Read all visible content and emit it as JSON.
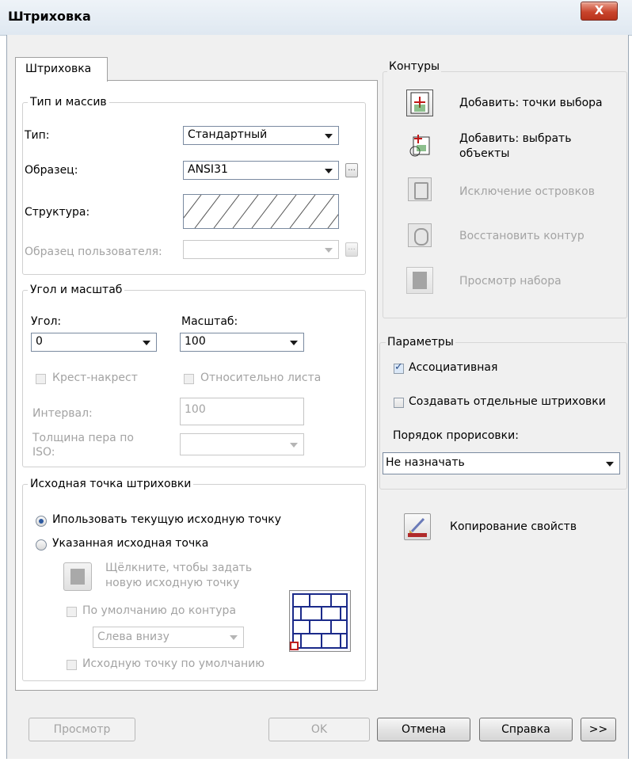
{
  "window": {
    "title": "Штриховка",
    "close_glyph": "X"
  },
  "tabs": [
    {
      "label": "Штриховка"
    }
  ],
  "type_group": {
    "legend": "Тип и массив",
    "type_label": "Тип:",
    "type_value": "Стандартный",
    "pattern_label": "Образец:",
    "pattern_value": "ANSI31",
    "ellipsis": "...",
    "structure_label": "Структура:",
    "custom_label": "Образец пользователя:",
    "custom_value": ""
  },
  "angle_group": {
    "legend": "Угол и масштаб",
    "angle_label": "Угол:",
    "angle_value": "0",
    "scale_label": "Масштаб:",
    "scale_value": "100",
    "double_label": "Крест-накрест",
    "relative_label": "Относительно листа",
    "spacing_label": "Интервал:",
    "spacing_value": "100",
    "pen_label_1": "Толщина пера по",
    "pen_label_2": "ISO:",
    "pen_value": ""
  },
  "origin_group": {
    "legend": "Исходная точка штриховки",
    "use_current_label": "Ипользовать текущую исходную точку",
    "use_current_selected": true,
    "specified_label": "Указанная исходная точка",
    "specified_selected": false,
    "click_text_1": "Щёлкните, чтобы задать",
    "click_text_2": "новую исходную точку",
    "default_boundary_label": "По умолчанию до контура",
    "position_value": "Слева внизу",
    "store_default_label": "Исходную точку по умолчанию"
  },
  "contours": {
    "legend": "Контуры",
    "add_pick_label": "Добавить: точки выбора",
    "add_select_label_1": "Добавить: выбрать",
    "add_select_label_2": "объекты",
    "remove_islands_label": "Исключение островков",
    "recreate_label": "Восстановить контур",
    "view_selection_label": "Просмотр набора"
  },
  "params": {
    "legend": "Параметры",
    "associative_label": "Ассоциативная",
    "associative_checked": true,
    "separate_label": "Создавать отдельные штриховки",
    "separate_checked": false,
    "draw_order_label": "Порядок прорисовки:",
    "draw_order_value": "Не назначать"
  },
  "inherit": {
    "label": "Копирование свойств"
  },
  "footer": {
    "preview": "Просмотр",
    "ok": "OK",
    "cancel": "Отмена",
    "help": "Справка",
    "more": ">>"
  }
}
